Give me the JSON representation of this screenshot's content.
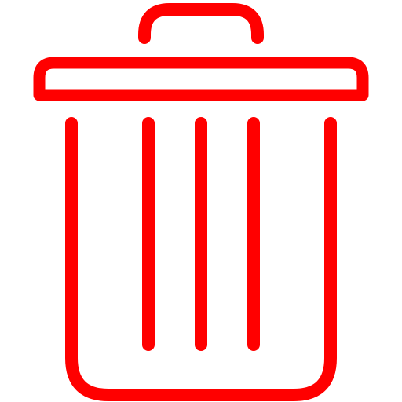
{
  "icon": {
    "name": "trash-can-icon",
    "stroke_color": "#ff0000",
    "background_color": "#ffffff"
  }
}
